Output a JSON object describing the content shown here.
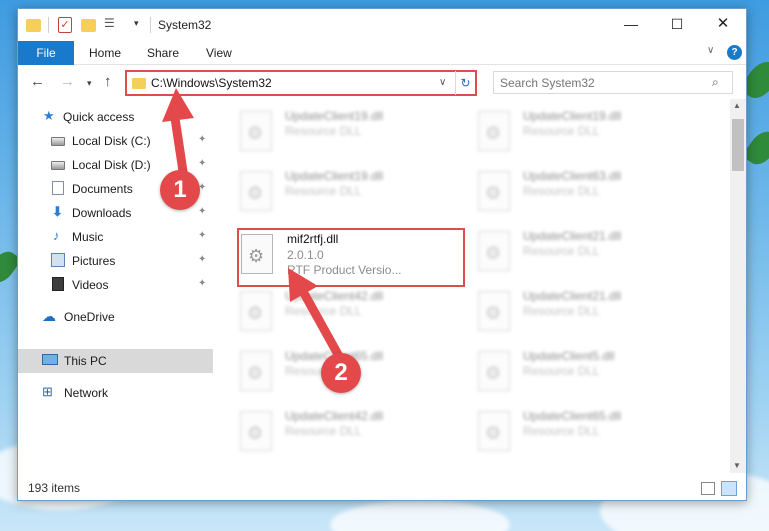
{
  "window": {
    "title": "System32",
    "minimize": "—",
    "maximize": "☐",
    "close": "✕"
  },
  "ribbon": {
    "tabs": [
      "File",
      "Home",
      "Share",
      "View"
    ],
    "help": "?"
  },
  "navigation": {
    "back": "←",
    "forward": "→",
    "recent": "▾",
    "up": "↑",
    "address_path": "C:\\Windows\\System32",
    "search_placeholder": "Search System32"
  },
  "sidebar": {
    "items": [
      {
        "label": "Quick access",
        "icon": "star-icon"
      },
      {
        "label": "Local Disk (C:)",
        "icon": "drive-icon",
        "pinned": true
      },
      {
        "label": "Local Disk (D:)",
        "icon": "drive-icon",
        "pinned": true
      },
      {
        "label": "Documents",
        "icon": "document-icon",
        "pinned": true
      },
      {
        "label": "Downloads",
        "icon": "download-icon",
        "pinned": true
      },
      {
        "label": "Music",
        "icon": "music-icon",
        "pinned": true
      },
      {
        "label": "Pictures",
        "icon": "pictures-icon",
        "pinned": true
      },
      {
        "label": "Videos",
        "icon": "video-icon",
        "pinned": true
      },
      {
        "label": "OneDrive",
        "icon": "cloud-icon"
      },
      {
        "label": "This PC",
        "icon": "computer-icon",
        "selected": true
      },
      {
        "label": "Network",
        "icon": "network-icon"
      }
    ]
  },
  "files": {
    "left_column": [
      {
        "name": "UpdateClient19.dll",
        "line2": "Resource DLL",
        "line3": ""
      },
      {
        "name": "UpdateClient19.dll",
        "line2": "Resource DLL",
        "line3": ""
      },
      {
        "name": "mif2rtfj.dll",
        "line2": "2.0.1.0",
        "line3": "RTF  Product Versio..."
      },
      {
        "name": "UpdateClient42.dll",
        "line2": "Resource DLL",
        "line3": ""
      },
      {
        "name": "UpdateClient65.dll",
        "line2": "Resource DLL",
        "line3": ""
      },
      {
        "name": "UpdateClient42.dll",
        "line2": "Resource DLL",
        "line3": ""
      }
    ],
    "right_column": [
      {
        "name": "UpdateClient19.dll",
        "line2": "Resource DLL"
      },
      {
        "name": "UpdateClient63.dll",
        "line2": "Resource DLL"
      },
      {
        "name": "UpdateClient21.dll",
        "line2": "Resource DLL"
      },
      {
        "name": "UpdateClient21.dll",
        "line2": "Resource DLL"
      },
      {
        "name": "UpdateClient5.dll",
        "line2": "Resource DLL"
      },
      {
        "name": "UpdateClient65.dll",
        "line2": "Resource DLL"
      }
    ]
  },
  "status": {
    "item_count": "193 items"
  },
  "annotations": {
    "step1": "1",
    "step2": "2",
    "color": "#e3494a"
  }
}
